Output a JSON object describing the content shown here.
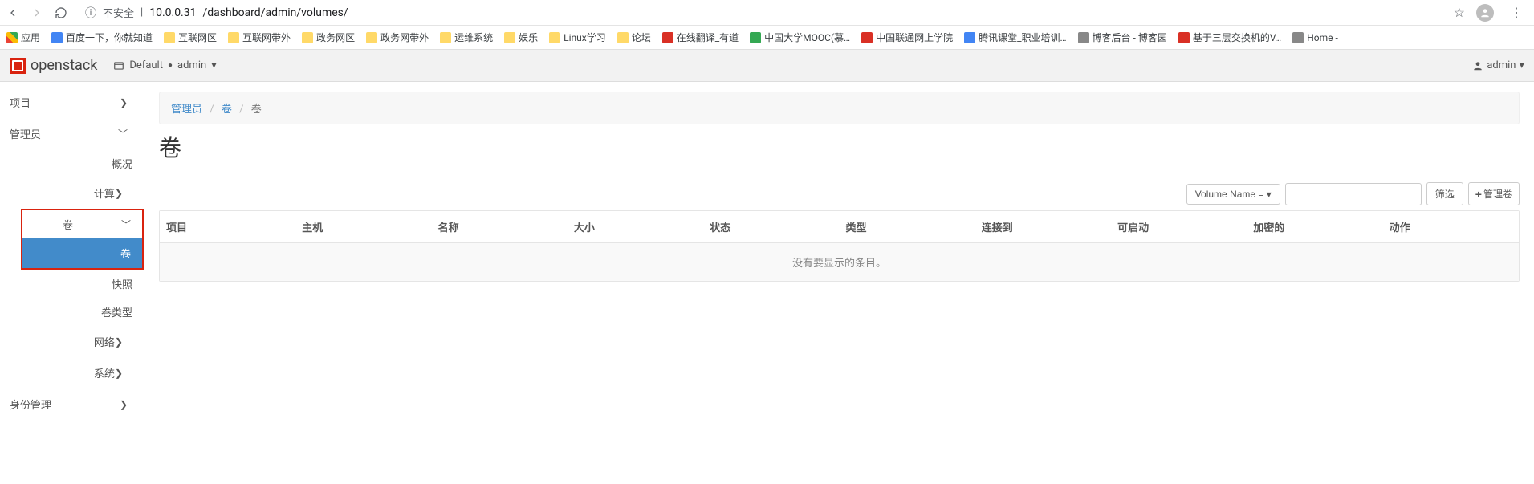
{
  "browser": {
    "insecure_label": "不安全",
    "url_protocol_host": "10.0.0.31",
    "url_path": "/dashboard/admin/volumes/"
  },
  "bookmarks": {
    "apps": "应用",
    "items": [
      {
        "label": "百度一下，你就知道",
        "icon": "bm-blue"
      },
      {
        "label": "互联网区",
        "icon": "folder-icon"
      },
      {
        "label": "互联网带外",
        "icon": "folder-icon"
      },
      {
        "label": "政务网区",
        "icon": "folder-icon"
      },
      {
        "label": "政务网带外",
        "icon": "folder-icon"
      },
      {
        "label": "运维系统",
        "icon": "folder-icon"
      },
      {
        "label": "娱乐",
        "icon": "folder-icon"
      },
      {
        "label": "Linux学习",
        "icon": "folder-icon"
      },
      {
        "label": "论坛",
        "icon": "folder-icon"
      },
      {
        "label": "在线翻译_有道",
        "icon": "bm-red"
      },
      {
        "label": "中国大学MOOC(慕…",
        "icon": "bm-green"
      },
      {
        "label": "中国联通网上学院",
        "icon": "bm-red"
      },
      {
        "label": "腾讯课堂_职业培训…",
        "icon": "bm-blue"
      },
      {
        "label": "博客后台 - 博客园",
        "icon": "generic-icon"
      },
      {
        "label": "基于三层交换机的V…",
        "icon": "bm-red"
      },
      {
        "label": "Home -",
        "icon": "generic-icon"
      }
    ]
  },
  "header": {
    "brand": "openstack",
    "domain_label": "Default",
    "project_label": "admin",
    "user_label": "admin"
  },
  "sidebar": {
    "project": "项目",
    "admin": "管理员",
    "overview": "概况",
    "compute": "计算",
    "volume": "卷",
    "volume_sub": {
      "volume": "卷",
      "snapshot": "快照",
      "volume_type": "卷类型"
    },
    "network": "网络",
    "system": "系统",
    "identity": "身份管理"
  },
  "breadcrumb": {
    "root": "管理员",
    "mid": "卷",
    "current": "卷"
  },
  "page": {
    "title": "卷"
  },
  "filter": {
    "dropdown": "Volume Name = ",
    "placeholder": "",
    "filter_btn": "筛选",
    "manage_btn": "管理卷"
  },
  "table": {
    "columns": [
      "项目",
      "主机",
      "名称",
      "大小",
      "状态",
      "类型",
      "连接到",
      "可启动",
      "加密的",
      "动作"
    ],
    "empty_text": "没有要显示的条目。"
  }
}
